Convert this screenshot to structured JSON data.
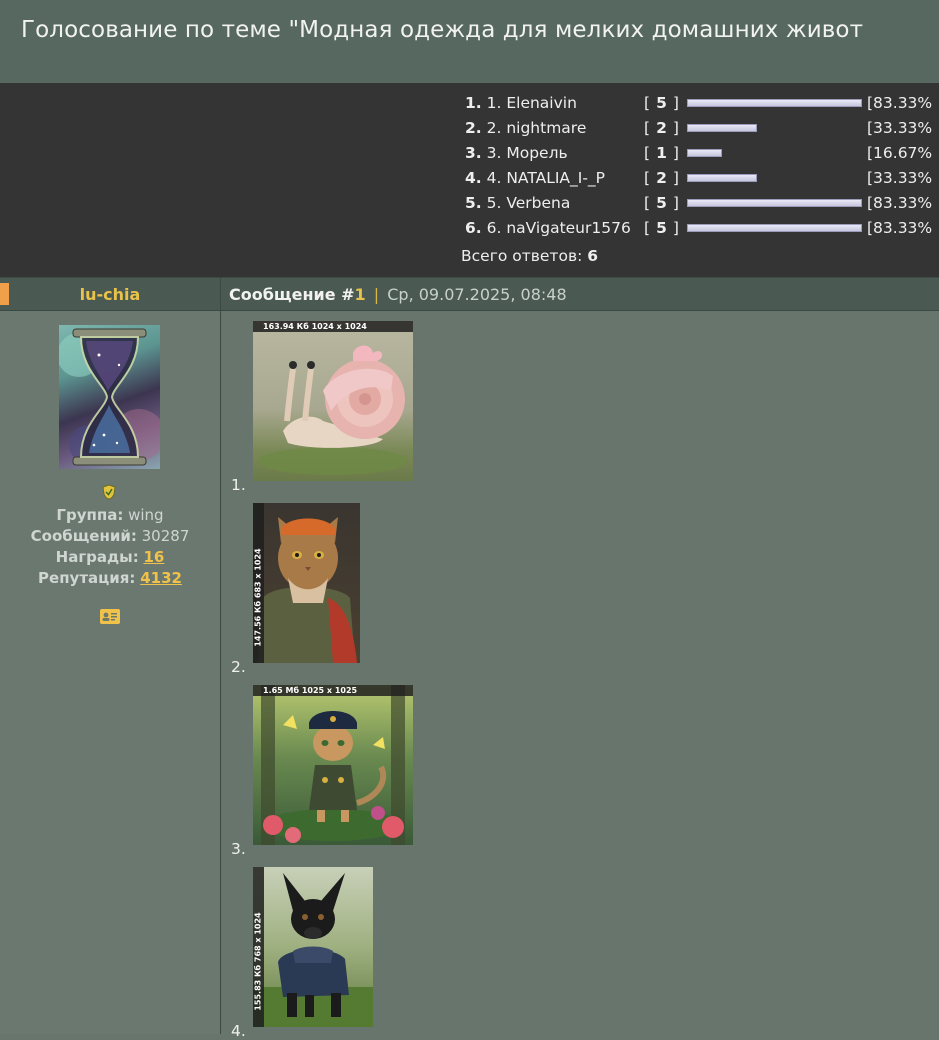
{
  "header": {
    "title": "Голосование по теме \"Модная одежда для мелких домашних живот"
  },
  "poll": {
    "rows": [
      {
        "num": "1.",
        "name": "1. Elenaivin",
        "votes": "5",
        "share": 1.0,
        "percent": "[83.33%"
      },
      {
        "num": "2.",
        "name": "2. nightmare",
        "votes": "2",
        "share": 0.4,
        "percent": "[33.33%"
      },
      {
        "num": "3.",
        "name": "3. Морель",
        "votes": "1",
        "share": 0.2,
        "percent": "[16.67%"
      },
      {
        "num": "4.",
        "name": "4. NATALIA_I-_P",
        "votes": "2",
        "share": 0.4,
        "percent": "[33.33%"
      },
      {
        "num": "5.",
        "name": "5. Verbena",
        "votes": "5",
        "share": 1.0,
        "percent": "[83.33%"
      },
      {
        "num": "6.",
        "name": "6. naVigateur1576",
        "votes": "5",
        "share": 1.0,
        "percent": "[83.33%"
      }
    ],
    "total_label": "Всего ответов:",
    "total_value": "6"
  },
  "post": {
    "author": "lu-chia",
    "label": "Сообщение #",
    "number": "1",
    "separator": "|",
    "date": "Ср, 09.07.2025, 08:48",
    "group_label": "Группа:",
    "group_value": "wing",
    "messages_label": "Сообщений:",
    "messages_value": "30287",
    "awards_label": "Награды:",
    "awards_value": "16",
    "rep_label": "Репутация:",
    "rep_value": "4132",
    "rank_icon": "shield-icon",
    "profile_icon": "id-card-icon"
  },
  "images": [
    {
      "index": "1.",
      "badge": "163.94 Кб 1024 x 1024",
      "badge_side": false
    },
    {
      "index": "2.",
      "badge": "147.56 Кб 683 x 1024",
      "badge_side": true
    },
    {
      "index": "3.",
      "badge": "1.65 Мб 1025 x 1025",
      "badge_side": false
    },
    {
      "index": "4.",
      "badge": "155.83 Кб 768 x 1024",
      "badge_side": true
    }
  ]
}
